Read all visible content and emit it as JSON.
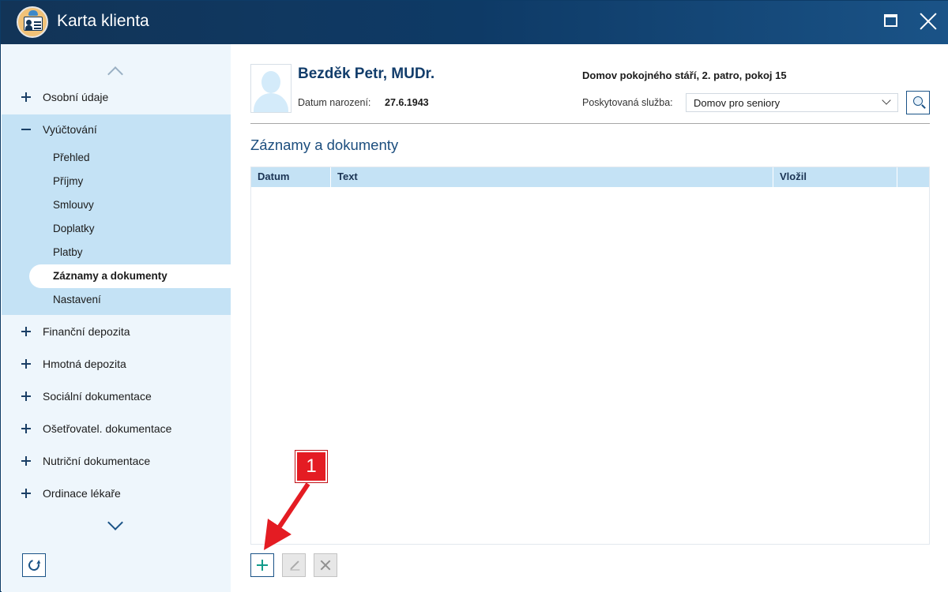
{
  "window": {
    "title": "Karta klienta"
  },
  "sidebar": {
    "items": [
      {
        "label": "Osobní údaje",
        "expanded": false
      },
      {
        "label": "Vyúčtování",
        "expanded": true
      },
      {
        "label": "Finanční depozita",
        "expanded": false
      },
      {
        "label": "Hmotná depozita",
        "expanded": false
      },
      {
        "label": "Sociální dokumentace",
        "expanded": false
      },
      {
        "label": "Ošetřovatel. dokumentace",
        "expanded": false
      },
      {
        "label": "Nutriční dokumentace",
        "expanded": false
      },
      {
        "label": "Ordinace lékaře",
        "expanded": false
      }
    ],
    "subitems": [
      {
        "label": "Přehled"
      },
      {
        "label": "Příjmy"
      },
      {
        "label": "Smlouvy"
      },
      {
        "label": "Doplatky"
      },
      {
        "label": "Platby"
      },
      {
        "label": "Záznamy a dokumenty",
        "active": true
      },
      {
        "label": "Nastavení"
      }
    ]
  },
  "patient": {
    "name": "Bezděk Petr, MUDr.",
    "dob_label": "Datum narození:",
    "dob_value": "27.6.1943",
    "location": "Domov pokojného stáří, 2. patro, pokoj 15",
    "service_label": "Poskytovaná služba:",
    "service_value": "Domov pro seniory"
  },
  "main": {
    "section_title": "Záznamy a dokumenty",
    "columns": [
      "Datum",
      "Text",
      "Vložil"
    ],
    "rows": []
  },
  "annotation": {
    "callout_number": "1"
  },
  "colors": {
    "titlebar": "#123457",
    "sidebar_bg": "#eef6fc",
    "sidebar_expanded_bg": "#c4e2f5",
    "accent": "#1a5387",
    "callout": "#e41c23"
  }
}
